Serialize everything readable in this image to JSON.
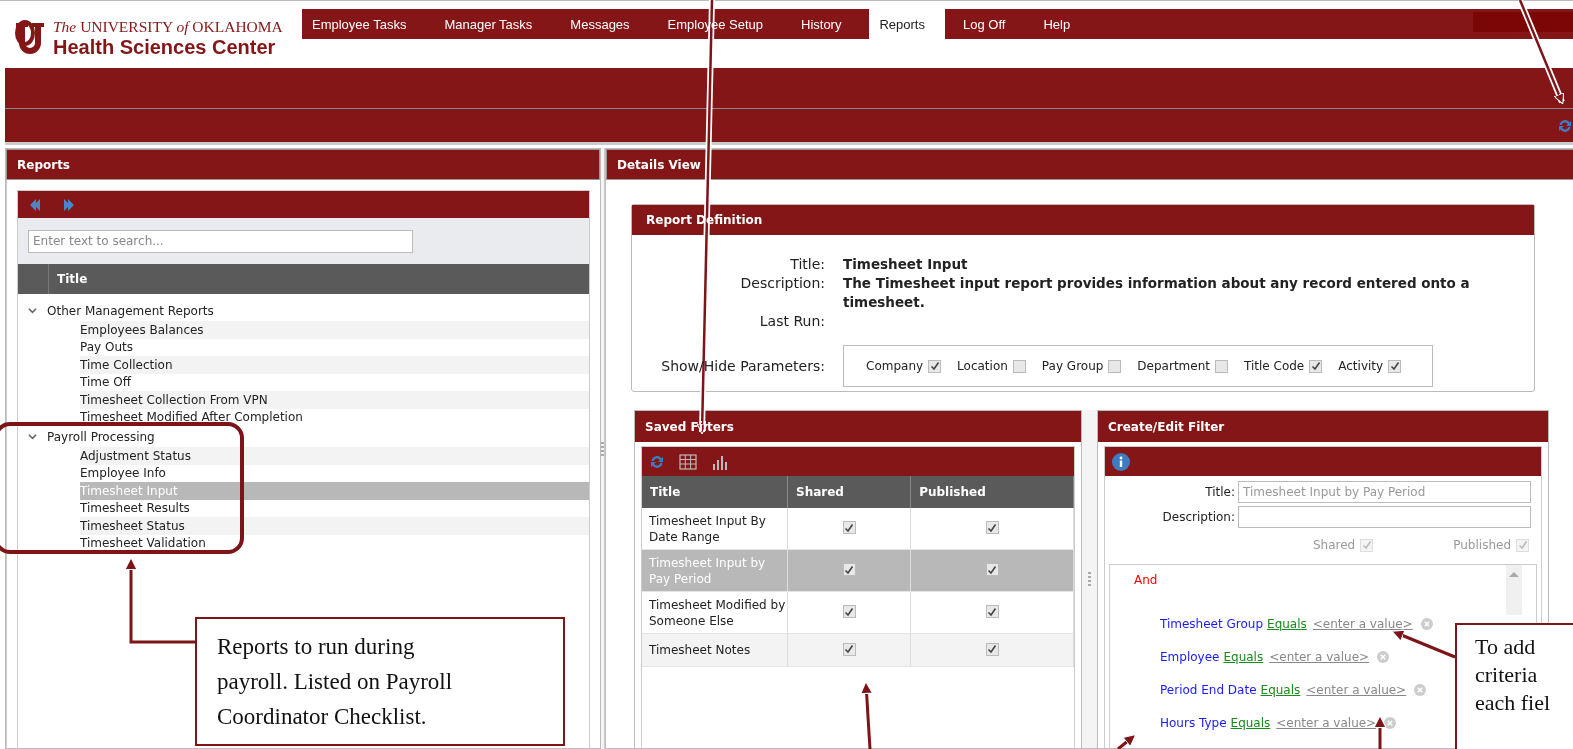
{
  "header": {
    "logo_line1": "*The* UNIVERSITY *of* OKLAHOMA",
    "logo_line2": "Health Sciences Center"
  },
  "nav": [
    {
      "label": "Employee Tasks",
      "selected": false
    },
    {
      "label": "Manager Tasks",
      "selected": false
    },
    {
      "label": "Messages",
      "selected": false
    },
    {
      "label": "Employee Setup",
      "selected": false
    },
    {
      "label": "History",
      "selected": false
    },
    {
      "label": "Reports",
      "selected": true
    },
    {
      "label": "Log Off",
      "selected": false
    },
    {
      "label": "Help",
      "selected": false
    }
  ],
  "reports_panel": {
    "title": "Reports",
    "search": {
      "placeholder": "Enter text to search..."
    },
    "column": "Title",
    "tree": [
      {
        "label": "Other Management Reports",
        "expanded": true,
        "children": [
          {
            "label": "Employees Balances",
            "selected": false
          },
          {
            "label": "Pay Outs",
            "selected": false
          },
          {
            "label": "Time Collection",
            "selected": false
          },
          {
            "label": "Time Off",
            "selected": false
          },
          {
            "label": "Timesheet Collection From VPN",
            "selected": false
          },
          {
            "label": "Timesheet Modified After Completion",
            "selected": false
          }
        ]
      },
      {
        "label": "Payroll Processing",
        "expanded": true,
        "children": [
          {
            "label": "Adjustment Status",
            "selected": false
          },
          {
            "label": "Employee Info",
            "selected": false
          },
          {
            "label": "Timesheet Input",
            "selected": true
          },
          {
            "label": "Timesheet Results",
            "selected": false
          },
          {
            "label": "Timesheet Status",
            "selected": false
          },
          {
            "label": "Timesheet Validation",
            "selected": false
          }
        ]
      }
    ]
  },
  "details_panel": {
    "title": "Details View",
    "report_definition": {
      "title": "Report Definition",
      "fields": [
        {
          "label": "Title:",
          "value": "Timesheet Input"
        },
        {
          "label": "Description:",
          "value": "The Timesheet input report provides information about any record entered onto a timesheet."
        },
        {
          "label": "Last Run:"
        }
      ],
      "parameters_label": "Show/Hide Parameters:",
      "parameters": [
        {
          "label": "Company",
          "checked": true
        },
        {
          "label": "Location",
          "checked": false
        },
        {
          "label": "Pay Group",
          "checked": false
        },
        {
          "label": "Department",
          "checked": false
        },
        {
          "label": "Title Code",
          "checked": true
        },
        {
          "label": "Activity",
          "checked": true
        }
      ]
    },
    "saved_filters": {
      "title": "Saved Filters",
      "columns": [
        "Title",
        "Shared",
        "Published"
      ],
      "rows": [
        {
          "title": "Timesheet Input By Date Range",
          "shared": true,
          "published": true,
          "selected": false
        },
        {
          "title": "Timesheet Input by Pay Period",
          "shared": true,
          "published": true,
          "selected": true
        },
        {
          "title": "Timesheet Modified by Someone Else",
          "shared": true,
          "published": true,
          "selected": false
        },
        {
          "title": "Timesheet Notes",
          "shared": true,
          "published": true,
          "selected": false
        }
      ]
    },
    "create_edit_filter": {
      "title": "Create/Edit Filter",
      "title_field": {
        "label": "Title:",
        "value": "Timesheet Input by Pay Period",
        "disabled": true
      },
      "description_field": {
        "label": "Description:"
      },
      "flags": [
        {
          "label": "Shared",
          "checked": true,
          "disabled": true
        },
        {
          "label": "Published",
          "checked": true,
          "disabled": true
        }
      ],
      "criteria": {
        "operator": "And",
        "conditions": [
          {
            "field": "Timesheet Group",
            "operator": "Equals",
            "value": "<enter a value>"
          },
          {
            "field": "Employee",
            "operator": "Equals",
            "value": "<enter a value>"
          },
          {
            "field": "Period End Date",
            "operator": "Equals",
            "value": "<enter a value>"
          },
          {
            "field": "Hours Type",
            "operator": "Equals",
            "value": "<enter a value>"
          }
        ]
      }
    }
  },
  "callouts": [
    {
      "lines": [
        "Reports to run during payroll. Listed on Payroll Coordinator Checklist."
      ]
    },
    {
      "lines": [
        "To add",
        "criteria",
        "each fiel"
      ]
    }
  ]
}
